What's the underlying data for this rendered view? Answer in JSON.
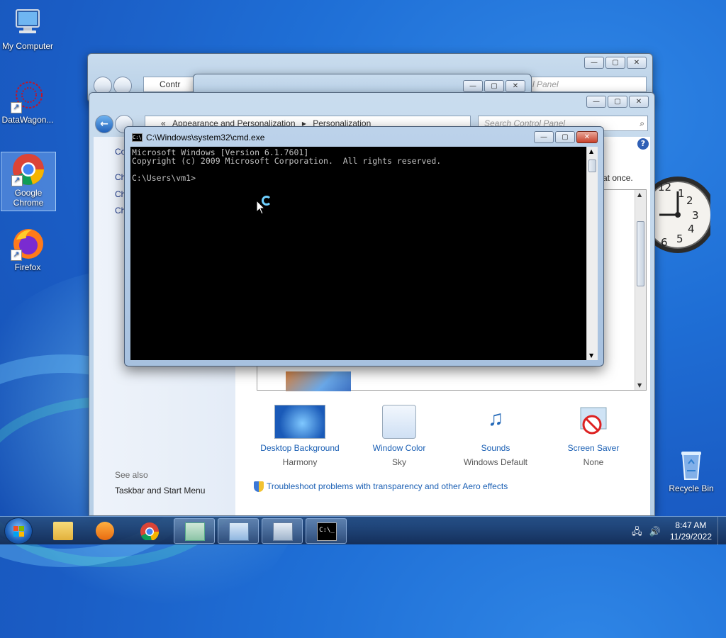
{
  "desktop": {
    "icons": [
      {
        "label": "My Computer"
      },
      {
        "label": "DataWagon..."
      },
      {
        "label": "Google Chrome"
      },
      {
        "label": "Firefox"
      },
      {
        "label": "Recycle Bin"
      }
    ]
  },
  "back_window": {
    "address": "Contr",
    "search": "l Panel"
  },
  "personalization": {
    "address_prefix": "«",
    "breadcrumb_1": "Appearance and Personalization",
    "breadcrumb_sep": "▸",
    "breadcrumb_2": "Personalization",
    "search_placeholder": "Search Control Panel",
    "left_items": [
      "Co",
      "Ch",
      "Ch",
      "Ch"
    ],
    "hint_text": "at once.",
    "see_also": "See also",
    "taskbar_link": "Taskbar and Start Menu",
    "options": [
      {
        "label": "Desktop Background",
        "sub": "Harmony"
      },
      {
        "label": "Window Color",
        "sub": "Sky"
      },
      {
        "label": "Sounds",
        "sub": "Windows Default"
      },
      {
        "label": "Screen Saver",
        "sub": "None"
      }
    ],
    "troubleshoot_link": "Troubleshoot problems with transparency and other Aero effects"
  },
  "cmd": {
    "title": "C:\\Windows\\system32\\cmd.exe",
    "line1": "Microsoft Windows [Version 6.1.7601]",
    "line2": "Copyright (c) 2009 Microsoft Corporation.  All rights reserved.",
    "line3": "",
    "line4": "C:\\Users\\vm1>"
  },
  "clock_gadget": {
    "n12": "12",
    "n1": "1",
    "n2": "2",
    "n3": "3",
    "n4": "4",
    "n5": "5",
    "n6": "6"
  },
  "taskbar": {
    "time": "8:47 AM",
    "date": "11/29/2022"
  },
  "colors": {
    "link": "#1a5fb4",
    "cmd_bg": "#000000",
    "cmd_text": "#c0c0c0"
  }
}
